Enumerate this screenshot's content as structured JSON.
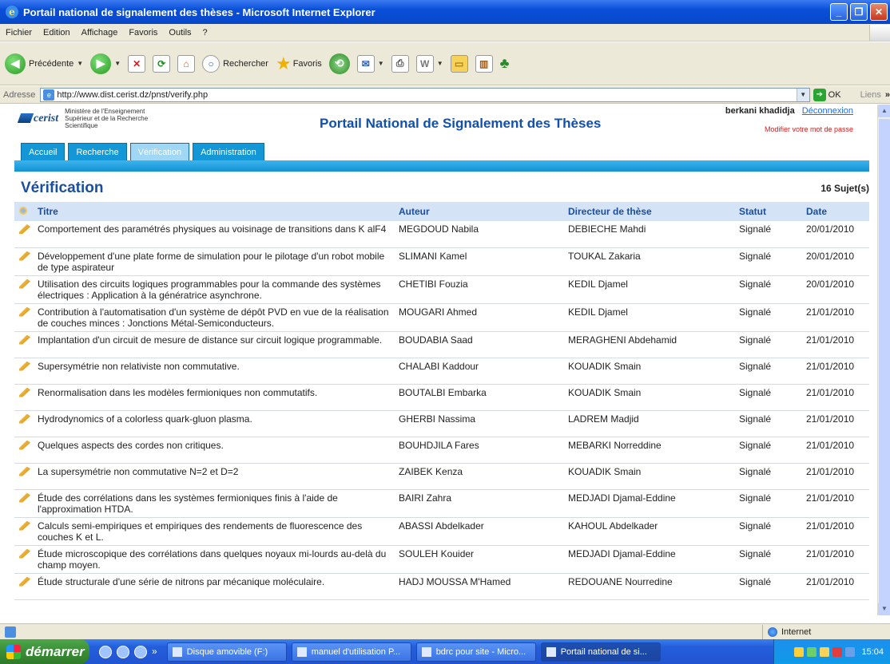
{
  "window": {
    "title": "Portail national de signalement des thèses - Microsoft Internet Explorer"
  },
  "menu": [
    "Fichier",
    "Edition",
    "Affichage",
    "Favoris",
    "Outils",
    "?"
  ],
  "toolbar": {
    "back_label": "Précédente",
    "search_label": "Rechercher",
    "favorites_label": "Favoris"
  },
  "address": {
    "label": "Adresse",
    "url": "http://www.dist.cerist.dz/pnst/verify.php",
    "go_label": "OK",
    "links_label": "Liens"
  },
  "header": {
    "logo_text": "cerist",
    "ministry": [
      "Ministère de l'Enseignement",
      "Supérieur et de la Recherche",
      "Scientifique"
    ],
    "site_title": "Portail National de Signalement des Thèses",
    "user_name": "berkani khadidja",
    "logout_label": "Déconnexion",
    "change_password_label": "Modifier votre mot de passe"
  },
  "tabs": [
    {
      "label": "Accueil",
      "active": false
    },
    {
      "label": "Recherche",
      "active": false
    },
    {
      "label": "Vérification",
      "active": true
    },
    {
      "label": "Administration",
      "active": false
    }
  ],
  "page": {
    "title": "Vérification",
    "count": "16 Sujet(s)"
  },
  "table": {
    "columns": [
      "Titre",
      "Auteur",
      "Directeur de thèse",
      "Statut",
      "Date"
    ],
    "rows": [
      {
        "title": "Comportement des paramétrés physiques au voisinage de transitions dans K alF4",
        "author": "MEGDOUD Nabila",
        "director": "DEBIECHE Mahdi",
        "status": "Signalé",
        "date": "20/01/2010"
      },
      {
        "title": "Développement d'une plate forme de simulation pour le pilotage d'un robot mobile de type aspirateur",
        "author": "SLIMANI Kamel",
        "director": "TOUKAL Zakaria",
        "status": "Signalé",
        "date": "20/01/2010"
      },
      {
        "title": "Utilisation des circuits logiques programmables pour la commande des systèmes électriques : Application à la génératrice asynchrone.",
        "author": "CHETIBI Fouzia",
        "director": "KEDIL Djamel",
        "status": "Signalé",
        "date": "20/01/2010"
      },
      {
        "title": "Contribution à l'automatisation d'un système de dépôt PVD en vue de la réalisation de couches minces : Jonctions Métal-Semiconducteurs.",
        "author": "MOUGARI Ahmed",
        "director": "KEDIL Djamel",
        "status": "Signalé",
        "date": "21/01/2010"
      },
      {
        "title": "Implantation d'un circuit de mesure de distance sur circuit logique programmable.",
        "author": "BOUDABIA Saad",
        "director": "MERAGHENI Abdehamid",
        "status": "Signalé",
        "date": "21/01/2010"
      },
      {
        "title": "Supersymétrie non relativiste non commutative.",
        "author": "CHALABI Kaddour",
        "director": "KOUADIK Smain",
        "status": "Signalé",
        "date": "21/01/2010"
      },
      {
        "title": "Renormalisation dans les modèles fermioniques non commutatifs.",
        "author": "BOUTALBI Embarka",
        "director": "KOUADIK Smain",
        "status": "Signalé",
        "date": "21/01/2010"
      },
      {
        "title": "Hydrodynomics of a colorless quark-gluon plasma.",
        "author": "GHERBI Nassima",
        "director": "LADREM Madjid",
        "status": "Signalé",
        "date": "21/01/2010"
      },
      {
        "title": "Quelques aspects des cordes non critiques.",
        "author": "BOUHDJILA Fares",
        "director": "MEBARKI Norreddine",
        "status": "Signalé",
        "date": "21/01/2010"
      },
      {
        "title": "La supersymétrie non commutative N=2 et D=2",
        "author": "ZAIBEK Kenza",
        "director": "KOUADIK Smain",
        "status": "Signalé",
        "date": "21/01/2010"
      },
      {
        "title": "Étude des corrélations dans les systèmes fermioniques finis à l'aide de l'approximation HTDA.",
        "author": "BAIRI Zahra",
        "director": "MEDJADI Djamal-Eddine",
        "status": "Signalé",
        "date": "21/01/2010"
      },
      {
        "title": "Calculs semi-empiriques et empiriques des rendements de fluorescence des couches K et L.",
        "author": "ABASSI Abdelkader",
        "director": "KAHOUL Abdelkader",
        "status": "Signalé",
        "date": "21/01/2010"
      },
      {
        "title": "Étude microscopique des corrélations dans quelques noyaux mi-lourds au-delà du champ moyen.",
        "author": "SOULEH Kouider",
        "director": "MEDJADI Djamal-Eddine",
        "status": "Signalé",
        "date": "21/01/2010"
      },
      {
        "title": "Étude structurale d'une série de nitrons par mécanique moléculaire.",
        "author": "HADJ MOUSSA M'Hamed",
        "director": "REDOUANE Nourredine",
        "status": "Signalé",
        "date": "21/01/2010"
      }
    ]
  },
  "statusbar": {
    "zone": "Internet"
  },
  "taskbar": {
    "start_label": "démarrer",
    "tasks": [
      {
        "label": "Disque amovible (F:)",
        "active": false
      },
      {
        "label": "manuel d'utilisation P...",
        "active": false
      },
      {
        "label": "bdrc pour site - Micro...",
        "active": false
      },
      {
        "label": "Portail national de si...",
        "active": true
      }
    ],
    "clock": "15:04"
  }
}
